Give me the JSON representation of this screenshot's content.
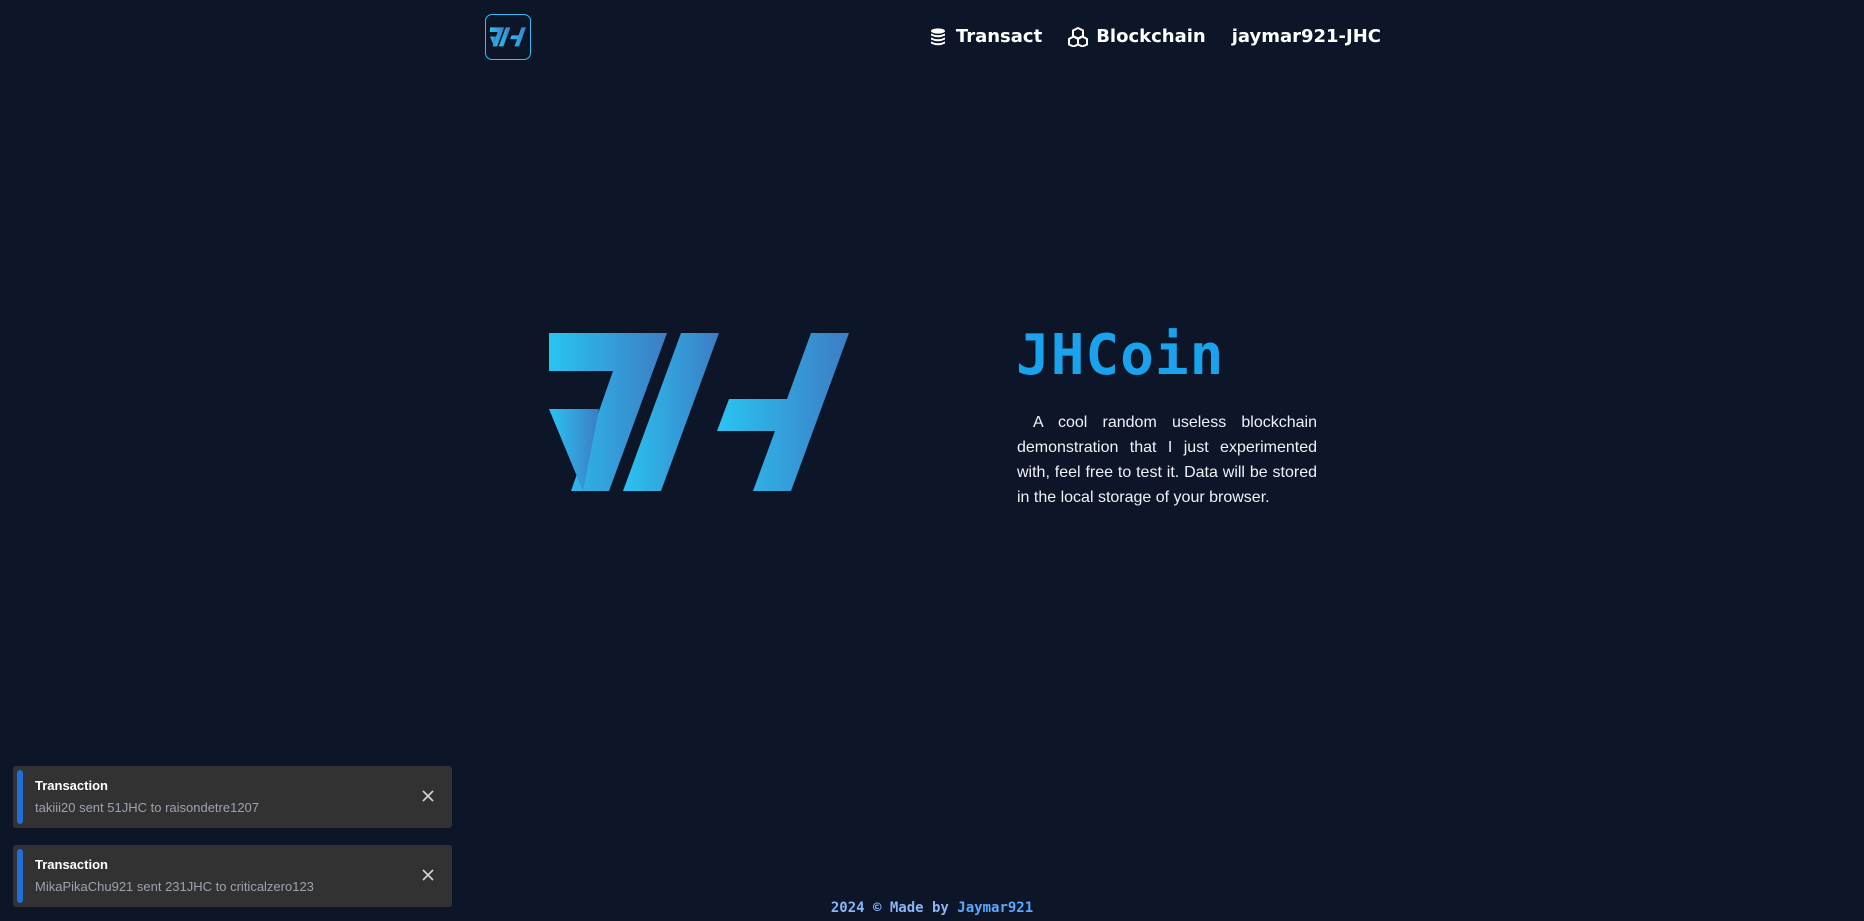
{
  "header": {
    "logo_icon": "jh-logo-icon",
    "nav": [
      {
        "label": "Transact",
        "icon": "coins-icon"
      },
      {
        "label": "Blockchain",
        "icon": "cubes-icon"
      },
      {
        "label": "jaymar921-JHC"
      }
    ]
  },
  "hero": {
    "title": "JHCoin",
    "description": "A cool random useless blockchain demonstration that I just experimented with, feel free to test it. Data will be stored in the local storage of your browser."
  },
  "toasts": [
    {
      "title": "Transaction",
      "message": "takiii20 sent 51JHC to raisondetre1207"
    },
    {
      "title": "Transaction",
      "message": "MikaPikaChu921 sent 231JHC to criticalzero123"
    }
  ],
  "footer": {
    "text": "2024 © Made by",
    "author": "Jaymar921"
  },
  "colors": {
    "background": "#0d1629",
    "accent": "#1aa3ec",
    "toast_bar": "#1e6fd9"
  }
}
